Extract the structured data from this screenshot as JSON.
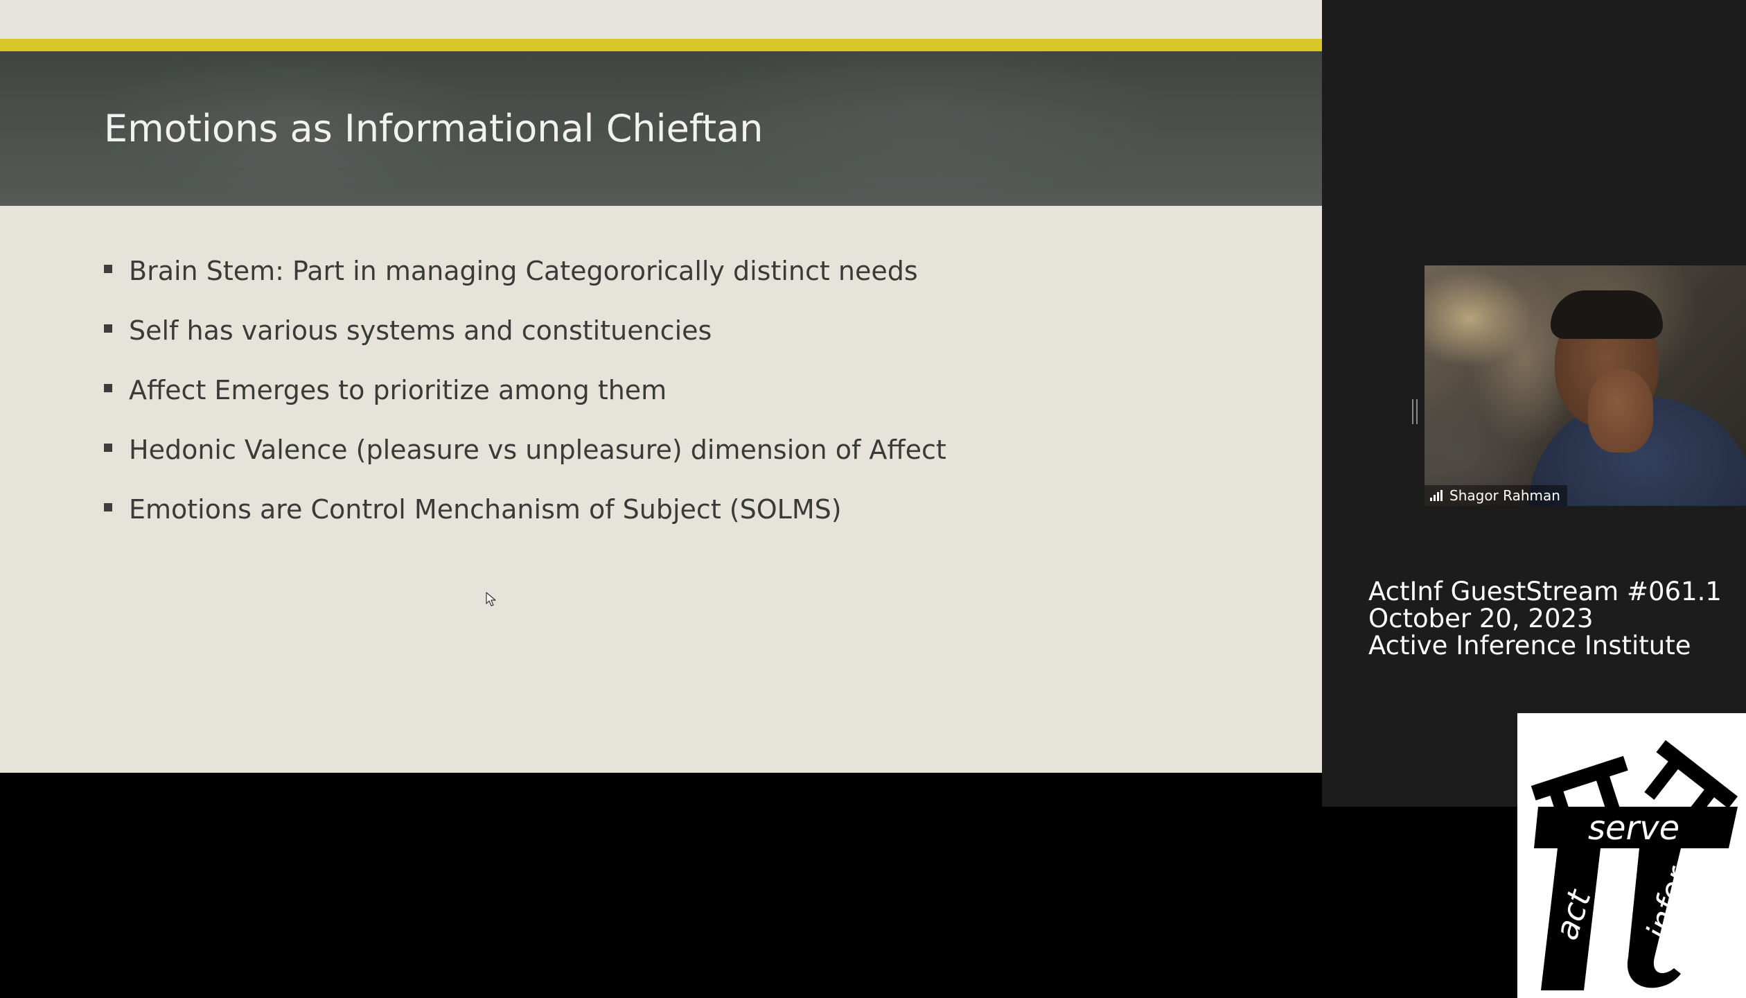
{
  "slide": {
    "title": "Emotions as Informational Chieftan",
    "bullets": [
      "Brain Stem: Part in managing Catego​rorically distinct needs",
      "Self has various systems and constituencies",
      "Affect Emerges to prioritize among them",
      "Hedonic Valence (pleasure vs unpleasure) dimension of Affect",
      "Emotions are Control Menchanism of Subject (SOLMS)"
    ]
  },
  "video": {
    "participant_name": "Shagor Rahman",
    "connection_icon": "signal-bars-icon"
  },
  "stream_info": {
    "line1": "ActInf GuestStream #061.1",
    "line2": "October 20, 2023",
    "line3": "Active Inference Institute"
  },
  "logo": {
    "word_serve": "serve",
    "word_act": "act",
    "word_infer": "infer"
  },
  "colors": {
    "accent_bar": "#d6c62a",
    "header_band": "#4a4f4c",
    "slide_background": "#e5e3da",
    "panel_background": "#1c1c1c"
  }
}
